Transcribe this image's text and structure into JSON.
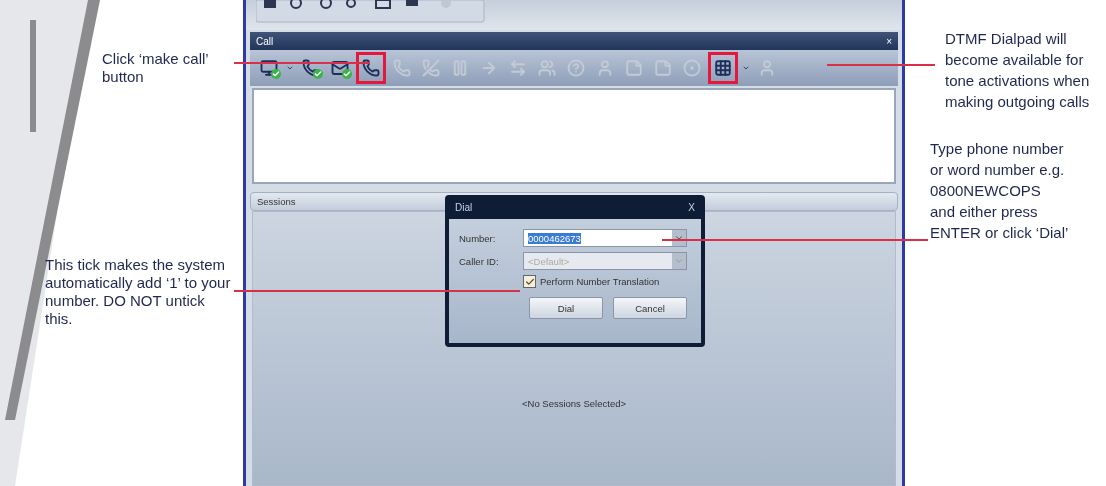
{
  "annotations": [
    {
      "kind": "left",
      "text": "Click ‘make call’ button"
    },
    {
      "kind": "left",
      "text": "This tick makes the system automatically add ‘1’ to your number. DO NOT untick this."
    },
    {
      "kind": "right",
      "text": "DTMF Dialpad will become available for tone activations when making outgoing calls"
    },
    {
      "kind": "right",
      "text": "Type phone number or word number e.g. 0800NEWCOPS and either press ENTER or click ‘Dial’"
    }
  ],
  "call_panel": {
    "title": "Call",
    "close": "×",
    "toolbar": [
      {
        "kind": "monitor",
        "disabled": false,
        "highlighted": false,
        "verified": true
      },
      {
        "kind": "caret",
        "disabled": false,
        "highlighted": false,
        "verified": false
      },
      {
        "kind": "phone",
        "disabled": false,
        "highlighted": false,
        "verified": true
      },
      {
        "kind": "mail",
        "disabled": false,
        "highlighted": false,
        "verified": true
      },
      {
        "kind": "phone",
        "disabled": false,
        "highlighted": true,
        "verified": false
      },
      {
        "kind": "phone",
        "disabled": true,
        "highlighted": false,
        "verified": false
      },
      {
        "kind": "hangup",
        "disabled": true,
        "highlighted": false,
        "verified": false
      },
      {
        "kind": "pause",
        "disabled": true,
        "highlighted": false,
        "verified": false
      },
      {
        "kind": "forward",
        "disabled": true,
        "highlighted": false,
        "verified": false
      },
      {
        "kind": "transfer",
        "disabled": true,
        "highlighted": false,
        "verified": false
      },
      {
        "kind": "conference",
        "disabled": true,
        "highlighted": false,
        "verified": false
      },
      {
        "kind": "help",
        "disabled": true,
        "highlighted": false,
        "verified": false
      },
      {
        "kind": "user",
        "disabled": true,
        "highlighted": false,
        "verified": false
      },
      {
        "kind": "notes",
        "disabled": true,
        "highlighted": false,
        "verified": false
      },
      {
        "kind": "notes",
        "disabled": true,
        "highlighted": false,
        "verified": false
      },
      {
        "kind": "record",
        "disabled": true,
        "highlighted": false,
        "verified": false
      },
      {
        "kind": "dialpad",
        "disabled": false,
        "highlighted": true,
        "verified": false
      },
      {
        "kind": "caret",
        "disabled": false,
        "highlighted": false,
        "verified": false
      },
      {
        "kind": "user",
        "disabled": true,
        "highlighted": false,
        "verified": false
      }
    ]
  },
  "sessions": {
    "title": "Sessions",
    "empty_text": "<No Sessions Selected>"
  },
  "dial_dialog": {
    "title": "Dial",
    "close": "X",
    "fields": [
      {
        "label": "Number:",
        "value": "0000462673",
        "selected": true,
        "disabled": false
      },
      {
        "label": "Caller ID:",
        "placeholder": "<Default>",
        "disabled": true
      }
    ],
    "checkbox": {
      "label": "Perform Number Translation",
      "checked": true
    },
    "buttons": [
      "Dial",
      "Cancel"
    ]
  }
}
